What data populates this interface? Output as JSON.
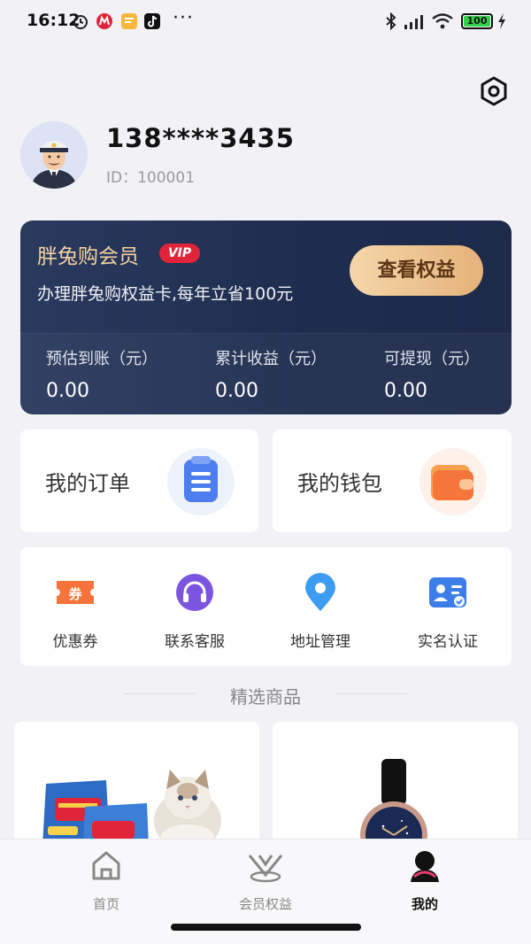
{
  "status_bar": {
    "time": "16:12",
    "dots": "···",
    "battery": "100",
    "icons": [
      "alarm-icon",
      "metro-icon",
      "notes-icon",
      "tiktok-icon",
      "bluetooth-icon",
      "signal-icon",
      "wifi-icon",
      "charging-icon"
    ]
  },
  "header": {
    "settings_icon": "settings-hexagon-icon"
  },
  "profile": {
    "phone": "138****3435",
    "id_label": "ID：",
    "id_value": "100001",
    "avatar_icon": "captain-avatar"
  },
  "vip": {
    "title": "胖兔购会员",
    "badge": "VIP",
    "subtitle": "办理胖兔购权益卡,每年立省100元",
    "button": "查看权益",
    "stats": [
      {
        "label": "预估到账（元）",
        "value": "0.00"
      },
      {
        "label": "累计收益（元）",
        "value": "0.00"
      },
      {
        "label": "可提现（元）",
        "value": "0.00"
      }
    ]
  },
  "quick_cards": [
    {
      "label": "我的订单",
      "icon": "order-list-icon"
    },
    {
      "label": "我的钱包",
      "icon": "wallet-icon"
    }
  ],
  "tools": [
    {
      "label": "优惠券",
      "icon": "coupon-icon"
    },
    {
      "label": "联系客服",
      "icon": "headset-icon"
    },
    {
      "label": "地址管理",
      "icon": "location-pin-icon"
    },
    {
      "label": "实名认证",
      "icon": "id-card-icon"
    }
  ],
  "section": {
    "title": "精选商品"
  },
  "products": [
    {
      "image": "cat-food-product"
    },
    {
      "image": "watch-product"
    }
  ],
  "bottom_nav": [
    {
      "label": "首页",
      "icon": "home-icon",
      "active": false
    },
    {
      "label": "会员权益",
      "icon": "member-benefits-icon",
      "active": false
    },
    {
      "label": "我的",
      "icon": "profile-icon",
      "active": true
    }
  ],
  "colors": {
    "vip_card_bg": "#1e2c4e",
    "vip_gold": "#f3d3a2",
    "vip_badge": "#e0243a",
    "battery": "#33d04b"
  }
}
